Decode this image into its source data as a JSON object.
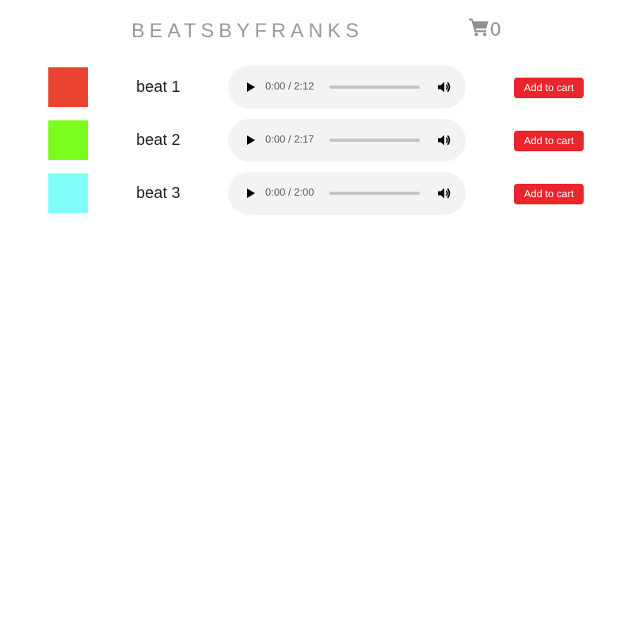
{
  "header": {
    "brand": "BEATSBYFRANKS",
    "cart_icon": "shopping-cart-icon",
    "cart_count": "0"
  },
  "beats": [
    {
      "title": "beat 1",
      "swatch_color": "#ea4430",
      "time": "0:00 / 2:12",
      "button_label": "Add to cart"
    },
    {
      "title": "beat 2",
      "swatch_color": "#7afc1c",
      "time": "0:00 / 2:17",
      "button_label": "Add to cart"
    },
    {
      "title": "beat 3",
      "swatch_color": "#80fdfb",
      "time": "0:00 / 2:00",
      "button_label": "Add to cart"
    }
  ],
  "player_icons": {
    "play": "play-icon",
    "volume": "volume-icon"
  },
  "colors": {
    "accent": "#e8262b",
    "player_bg": "#f1f3f4",
    "brand_text": "#9a9a9a"
  }
}
